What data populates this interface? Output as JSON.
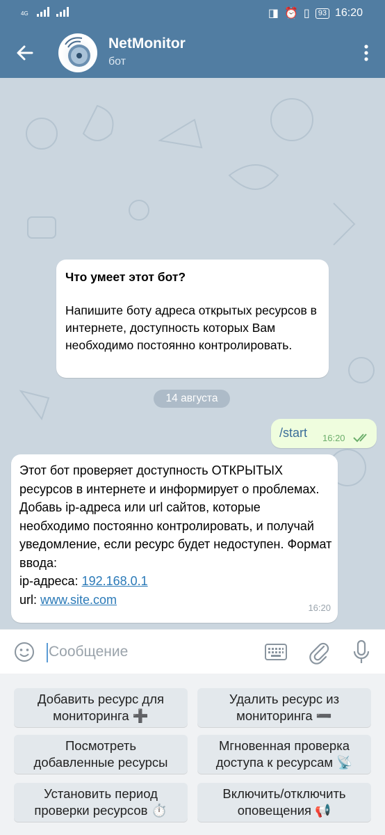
{
  "status_bar": {
    "network": "4G",
    "battery": "93",
    "time": "16:20"
  },
  "header": {
    "title": "NetMonitor",
    "subtitle": "бот"
  },
  "info_card": {
    "heading": "Что умеет этот бот?",
    "text": "Напишите боту адреса открытых ресурсов в интернете, доступность которых Вам необходимо постоянно контролировать."
  },
  "date_chip": "14 августа",
  "outgoing": {
    "text": "/start",
    "time": "16:20"
  },
  "incoming": {
    "text": "Этот бот проверяет доступность ОТКРЫТЫХ ресурсов в интернете и информирует о проблемах. Добавь ip-адреса или url сайтов, которые необходимо постоянно контролировать, и получай уведомление, если ресурс будет недоступен. Формат ввода:",
    "ip_label": "ip-адреса: ",
    "ip_link": "192.168.0.1",
    "url_label": "url: ",
    "url_link": "www.site.com",
    "time": "16:20"
  },
  "input": {
    "placeholder": "Сообщение"
  },
  "keyboard": {
    "buttons": [
      {
        "line1": "Добавить ресурс для",
        "line2": "мониторинга ➕"
      },
      {
        "line1": "Удалить ресурс из",
        "line2": "мониторинга ➖"
      },
      {
        "line1": "Посмотреть",
        "line2": "добавленные ресурсы"
      },
      {
        "line1": "Мгновенная проверка",
        "line2": "доступа к ресурсам 📡"
      },
      {
        "line1": "Установить период",
        "line2": "проверки ресурсов ⏱️"
      },
      {
        "line1": "Включить/отключить",
        "line2": "оповещения 📢"
      }
    ]
  },
  "colors": {
    "header": "#517da2",
    "link": "#2b7ab8",
    "outgoing_bubble": "#effdde"
  }
}
